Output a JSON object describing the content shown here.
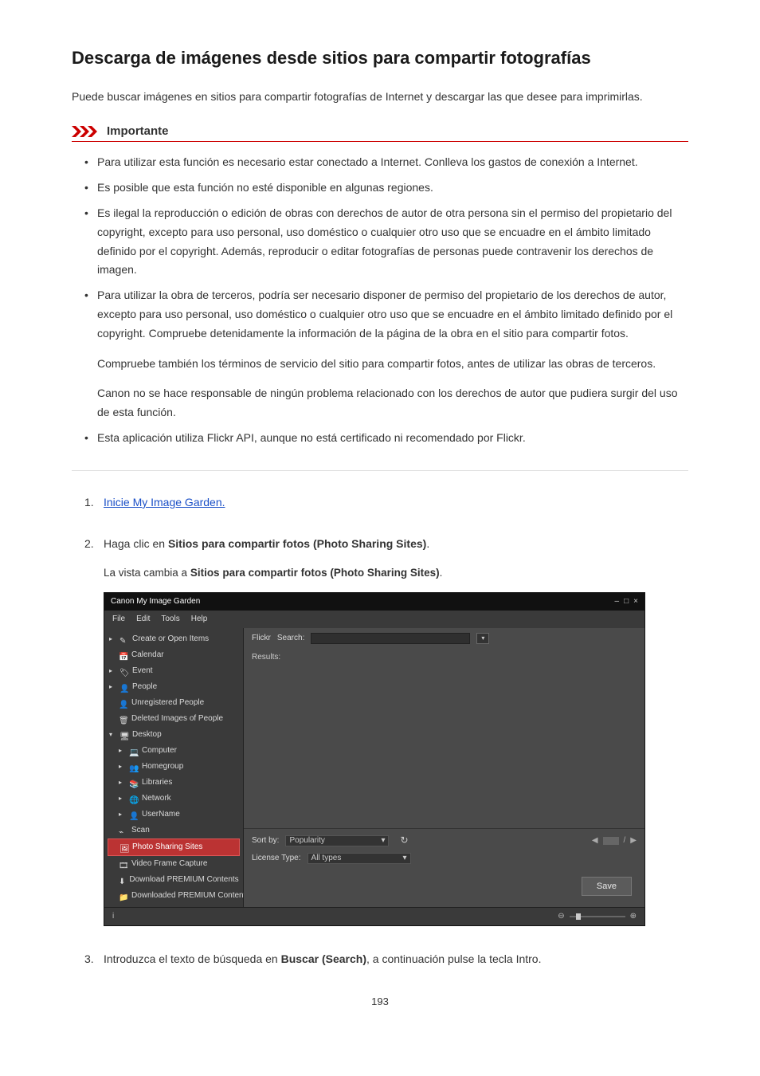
{
  "title": "Descarga de imágenes desde sitios para compartir fotografías",
  "intro": "Puede buscar imágenes en sitios para compartir fotografías de Internet y descargar las que desee para imprimirlas.",
  "importante": {
    "label": "Importante",
    "items": [
      "Para utilizar esta función es necesario estar conectado a Internet. Conlleva los gastos de conexión a Internet.",
      "Es posible que esta función no esté disponible en algunas regiones.",
      "Es ilegal la reproducción o edición de obras con derechos de autor de otra persona sin el permiso del propietario del copyright, excepto para uso personal, uso doméstico o cualquier otro uso que se encuadre en el ámbito limitado definido por el copyright. Además, reproducir o editar fotografías de personas puede contravenir los derechos de imagen.",
      "Para utilizar la obra de terceros, podría ser necesario disponer de permiso del propietario de los derechos de autor, excepto para uso personal, uso doméstico o cualquier otro uso que se encuadre en el ámbito limitado definido por el copyright. Compruebe detenidamente la información de la página de la obra en el sitio para compartir fotos.",
      "Esta aplicación utiliza Flickr API, aunque no está certificado ni recomendado por Flickr."
    ],
    "sub_paras": [
      "Compruebe también los términos de servicio del sitio para compartir fotos, antes de utilizar las obras de terceros.",
      "Canon no se hace responsable de ningún problema relacionado con los derechos de autor que pudiera surgir del uso de esta función."
    ]
  },
  "steps": {
    "s1_link": "Inicie My Image Garden.",
    "s2_pre": "Haga clic en ",
    "s2_bold": "Sitios para compartir fotos (Photo Sharing Sites)",
    "s2_post": ".",
    "s2_sub_pre": "La vista cambia a ",
    "s2_sub_bold": "Sitios para compartir fotos (Photo Sharing Sites)",
    "s2_sub_post": ".",
    "s3_pre": "Introduzca el texto de búsqueda en ",
    "s3_bold": "Buscar (Search)",
    "s3_post": ", a continuación pulse la tecla Intro."
  },
  "app": {
    "title": "Canon My Image Garden",
    "menu": [
      "File",
      "Edit",
      "Tools",
      "Help"
    ],
    "tree": {
      "create": "Create or Open Items",
      "calendar": "Calendar",
      "event": "Event",
      "people": "People",
      "unreg": "Unregistered People",
      "deleted": "Deleted Images of People",
      "desktop": "Desktop",
      "computer": "Computer",
      "homegroup": "Homegroup",
      "libraries": "Libraries",
      "network": "Network",
      "username": "UserName",
      "scan": "Scan",
      "photo_sharing": "Photo Sharing Sites",
      "video": "Video Frame Capture",
      "dl_premium": "Download PREMIUM Contents",
      "dled_premium": "Downloaded PREMIUM Contents"
    },
    "search": {
      "provider": "Flickr",
      "label": "Search:",
      "results_label": "Results:"
    },
    "sortbar": {
      "sort_by_label": "Sort by:",
      "sort_by_value": "Popularity",
      "license_label": "License Type:",
      "license_value": "All types",
      "page_sep": "/"
    },
    "save_label": "Save",
    "status_info": "i"
  },
  "page_number": "193"
}
